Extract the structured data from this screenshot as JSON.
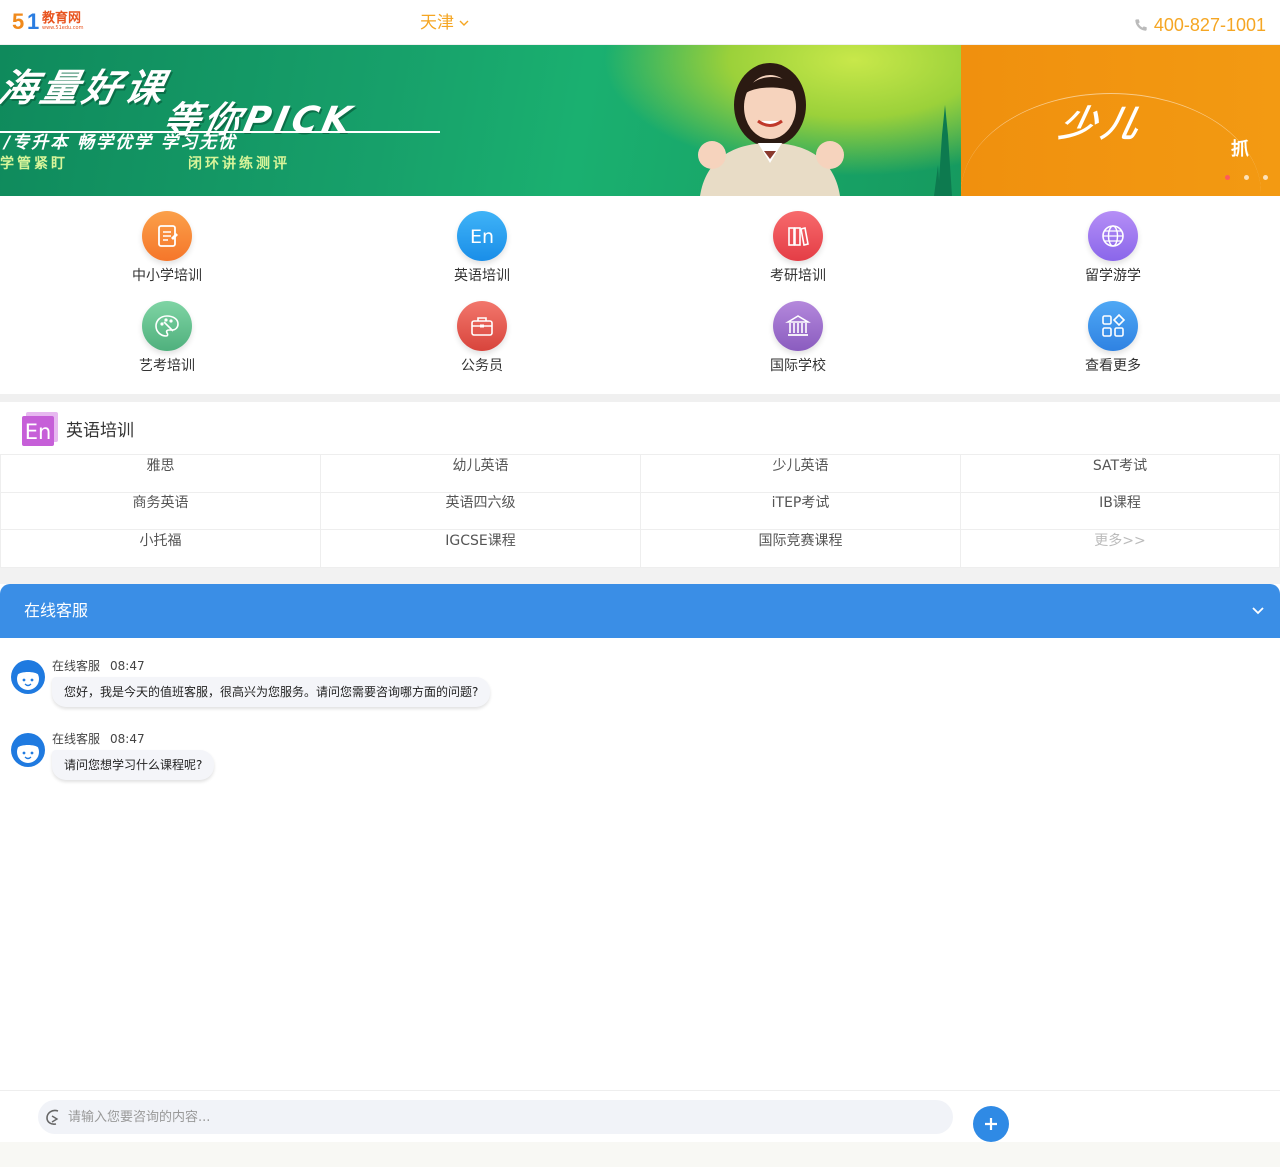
{
  "header": {
    "logo_num": "51",
    "logo_five": "5",
    "logo_one": "1",
    "logo_name": "教育网",
    "logo_url": "www.51edu.com",
    "city": "天津",
    "phone": "400-827-1001"
  },
  "banner": {
    "slide1": {
      "line1": "海量好课",
      "line2": "等你PICK",
      "line3": "/专升本  畅学优学  学习无忧",
      "line4a": "学管紧盯",
      "line4b": "闭环讲练测评"
    },
    "slide2": {
      "line1": "少儿",
      "line2": "抓"
    },
    "dots_total": 3,
    "active_dot": 1
  },
  "categories": [
    {
      "label": "中小学培训",
      "icon": "notepad-icon",
      "color": "#f7882a"
    },
    {
      "label": "英语培训",
      "icon": "en-icon",
      "color": "#1e98ef"
    },
    {
      "label": "考研培训",
      "icon": "books-icon",
      "color": "#ef4f55"
    },
    {
      "label": "留学游学",
      "icon": "globe-icon",
      "color": "#9a78ef"
    },
    {
      "label": "艺考培训",
      "icon": "palette-icon",
      "color": "#62c08e"
    },
    {
      "label": "公务员",
      "icon": "briefcase-icon",
      "color": "#e8574e"
    },
    {
      "label": "国际学校",
      "icon": "school-building-icon",
      "color": "#9a6cc8"
    },
    {
      "label": "查看更多",
      "icon": "grid-more-icon",
      "color": "#2f8ae5"
    }
  ],
  "english_section": {
    "icon_text": "En",
    "title": "英语培训",
    "rows": [
      [
        "雅思",
        "幼儿英语",
        "少儿英语",
        "SAT考试"
      ],
      [
        "商务英语",
        "英语四六级",
        "iTEP考试",
        "IB课程"
      ],
      [
        "小托福",
        "IGCSE课程",
        "国际竞赛课程",
        "更多>>"
      ]
    ]
  },
  "chat": {
    "title": "在线客服",
    "messages": [
      {
        "sender": "在线客服",
        "time": "08:47",
        "text": "您好，我是今天的值班客服，很高兴为您服务。请问您需要咨询哪方面的问题?"
      },
      {
        "sender": "在线客服",
        "time": "08:47",
        "text": "请问您想学习什么课程呢?"
      }
    ],
    "input_placeholder": "请输入您要咨询的内容..."
  }
}
